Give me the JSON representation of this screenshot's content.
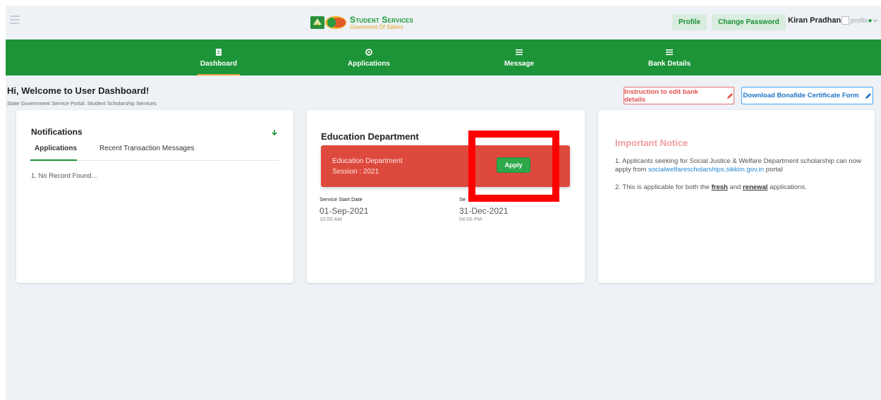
{
  "header": {
    "logo_title": "Student Services",
    "logo_subtitle": "Govmment Of Sikkim",
    "profile_label": "Profile",
    "change_password_label": "Change Password",
    "user_name": "Kiran Pradhan",
    "avatar_alt": "profile"
  },
  "nav": {
    "items": [
      {
        "label": "Dashboard",
        "icon": "clipboard-icon",
        "active": true
      },
      {
        "label": "Applications",
        "icon": "gear-icon",
        "active": false
      },
      {
        "label": "Message",
        "icon": "menu-icon",
        "active": false
      },
      {
        "label": "Bank Details",
        "icon": "menu-icon",
        "active": false
      }
    ]
  },
  "welcome": {
    "title": "Hi, Welcome to User Dashboard!",
    "subtitle": "State Government Service Portal. Student Scholarship Services"
  },
  "actions": {
    "bank_instruction_label": "Instruction to edit bank details",
    "bonafide_label": "Download Bonafide Certificate Form"
  },
  "notifications": {
    "title": "Notifications",
    "tabs": [
      "Applications",
      "Recent Transaction Messages"
    ],
    "empty_text": "1. No Record Found..."
  },
  "education": {
    "title": "Education Department",
    "banner_name": "Education Department",
    "banner_session": "Session : 2021",
    "apply_label": "Apply",
    "start_label": "Service Start Date",
    "start_date": "01-Sep-2021",
    "start_time": "10:00 AM",
    "end_label": "Se",
    "end_date": "31-Dec-2021",
    "end_time": "04:00 PM"
  },
  "notice": {
    "title": "Important Notice",
    "p1_text": "1. Applicants seeking for Social Justice & Welfare Department scholarship can now apply from",
    "p1_link": "socialwelfarescholarships.sikkim.gov.in",
    "p1_suffix": "portal",
    "p2_text": "2. This is applicable for both the",
    "p2_fresh": "fresh",
    "p2_and": "and",
    "p2_renewal": "renewal",
    "p2_suffix": "applications."
  },
  "colors": {
    "nav_green": "#1c9437",
    "banner_red": "#dd4a3d",
    "highlight_red": "#ff0000",
    "accent_orange": "#f2a33a"
  }
}
